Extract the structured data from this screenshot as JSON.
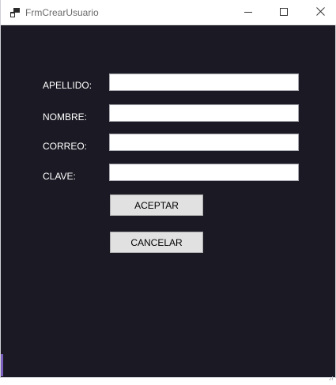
{
  "window": {
    "title": "FrmCrearUsuario",
    "icons": {
      "app": "app-window-icon",
      "minimize": "minimize-icon",
      "maximize": "maximize-icon",
      "close": "close-icon",
      "grip": "resize-grip-icon"
    },
    "colors": {
      "background": "#1b1a24",
      "titlebar": "#ffffff",
      "label_text": "#ffffff",
      "button_face": "#e1e1e1"
    }
  },
  "form": {
    "fields": [
      {
        "label": "APELLIDO:",
        "value": ""
      },
      {
        "label": "NOMBRE:",
        "value": ""
      },
      {
        "label": "CORREO:",
        "value": ""
      },
      {
        "label": "CLAVE:",
        "value": ""
      }
    ],
    "accept_label": "ACEPTAR",
    "cancel_label": "CANCELAR"
  }
}
